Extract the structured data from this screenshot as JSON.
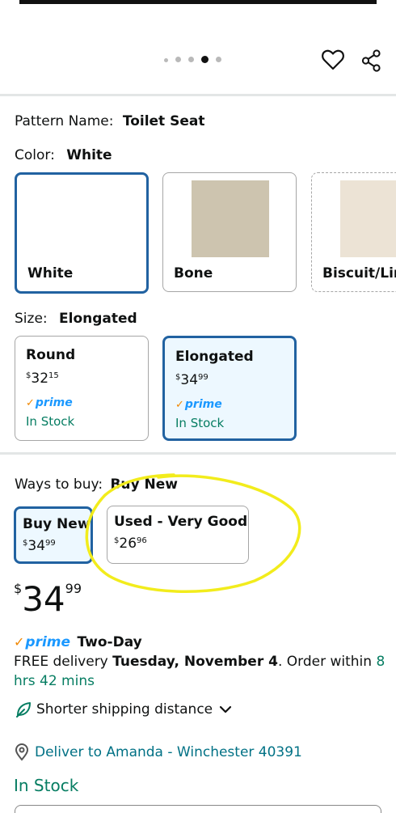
{
  "carousel": {
    "dot_count": 5,
    "active_index": 3
  },
  "pattern": {
    "label": "Pattern Name:",
    "value": "Toilet Seat"
  },
  "color": {
    "label": "Color:",
    "value": "White",
    "swatches": [
      {
        "name": "White",
        "color": "#ffffff",
        "selected": true
      },
      {
        "name": "Bone",
        "color": "#cdc4af",
        "selected": false
      },
      {
        "name": "Biscuit/Lir",
        "color": "#ece3d5",
        "selected": false
      }
    ]
  },
  "size": {
    "label": "Size:",
    "value": "Elongated",
    "options": [
      {
        "name": "Round",
        "price_currency": "$",
        "price_whole": "32",
        "price_cents": "15",
        "prime": "prime",
        "stock": "In Stock",
        "selected": false
      },
      {
        "name": "Elongated",
        "price_currency": "$",
        "price_whole": "34",
        "price_cents": "99",
        "prime": "prime",
        "stock": "In Stock",
        "selected": true
      }
    ]
  },
  "ways_to_buy": {
    "label": "Ways to buy:",
    "value": "Buy New",
    "options": [
      {
        "name": "Buy New",
        "price_currency": "$",
        "price_whole": "34",
        "price_cents": "99",
        "selected": true
      },
      {
        "name": "Used - Very Good",
        "price_currency": "$",
        "price_whole": "26",
        "price_cents": "96",
        "selected": false
      }
    ]
  },
  "price": {
    "currency": "$",
    "whole": "34",
    "cents": "99"
  },
  "delivery": {
    "prime_label": "prime",
    "speed": "Two-Day",
    "prefix": "FREE delivery ",
    "date": "Tuesday, November 4",
    "middle": ". Order within ",
    "countdown": "8 hrs 42 mins"
  },
  "shipping": {
    "label": "Shorter shipping distance"
  },
  "deliver_to": {
    "label": "Deliver to Amanda - Winchester 40391"
  },
  "stock_status": "In Stock",
  "annotation": {
    "color": "#f2ec1c"
  }
}
